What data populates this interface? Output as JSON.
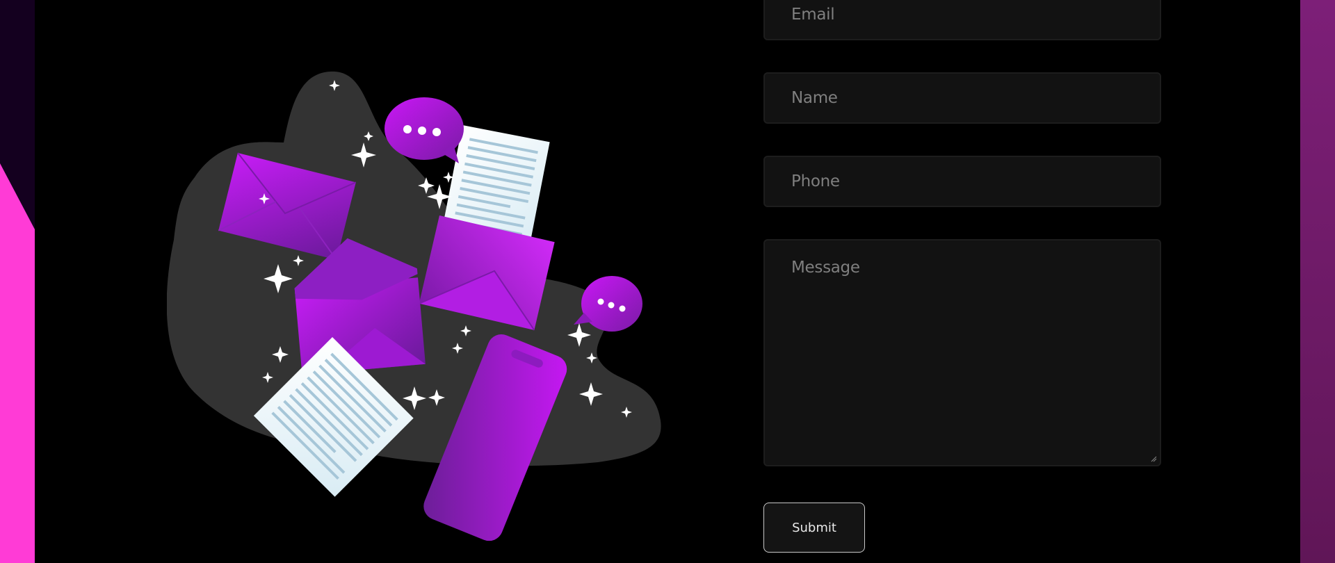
{
  "form": {
    "email": {
      "placeholder": "Email",
      "value": ""
    },
    "name": {
      "placeholder": "Name",
      "value": ""
    },
    "phone": {
      "placeholder": "Phone",
      "value": ""
    },
    "message": {
      "placeholder": "Message",
      "value": ""
    },
    "submit_label": "Submit"
  },
  "illustration": {
    "subject": "contact-mail-illustration"
  },
  "colors": {
    "background": "#000000",
    "accent_pink": "#ff3bd6",
    "accent_purple": "#b514f0",
    "field_bg": "#121212",
    "right_strip": "#7d1f78"
  }
}
